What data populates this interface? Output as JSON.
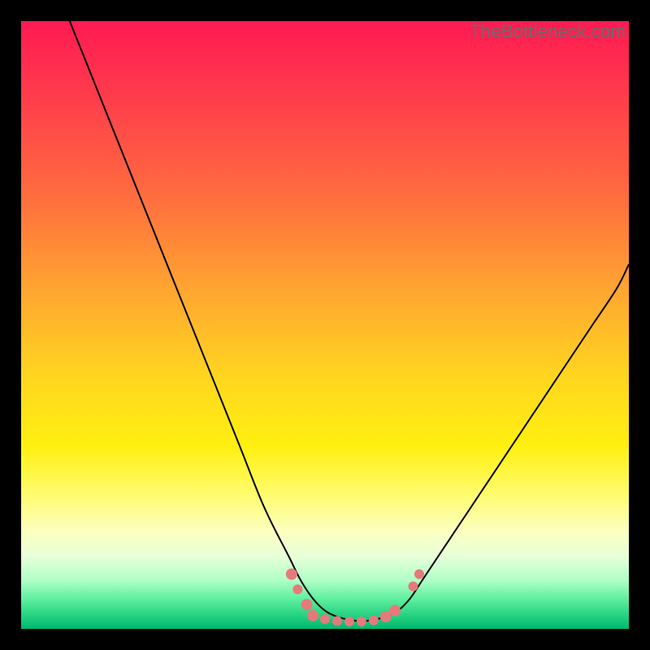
{
  "watermark": "TheBottleneck.com",
  "chart_data": {
    "type": "line",
    "title": "",
    "xlabel": "",
    "ylabel": "",
    "xlim": [
      0,
      100
    ],
    "ylim": [
      0,
      100
    ],
    "grid": false,
    "legend": false,
    "series": [
      {
        "name": "bottleneck-curve-left",
        "x": [
          8,
          12,
          16,
          20,
          24,
          28,
          32,
          36,
          40,
          44,
          46,
          48,
          50,
          52,
          54,
          56
        ],
        "y": [
          100,
          90,
          80,
          70,
          60,
          50,
          40,
          30,
          20,
          12,
          8,
          5,
          3,
          2,
          1.5,
          1.2
        ]
      },
      {
        "name": "bottleneck-curve-right",
        "x": [
          56,
          58,
          60,
          62,
          64,
          66,
          70,
          74,
          78,
          82,
          86,
          90,
          94,
          98,
          100
        ],
        "y": [
          1.2,
          1.5,
          2,
          3,
          5,
          8,
          14,
          20,
          26,
          32,
          38,
          44,
          50,
          56,
          60
        ]
      }
    ],
    "markers": [
      {
        "x": 44.5,
        "y": 9,
        "r": 7
      },
      {
        "x": 45.5,
        "y": 6.5,
        "r": 6
      },
      {
        "x": 47.0,
        "y": 4,
        "r": 7
      },
      {
        "x": 48.0,
        "y": 2.2,
        "r": 7
      },
      {
        "x": 50.0,
        "y": 1.6,
        "r": 6
      },
      {
        "x": 52.0,
        "y": 1.3,
        "r": 6
      },
      {
        "x": 54.0,
        "y": 1.2,
        "r": 6
      },
      {
        "x": 56.0,
        "y": 1.2,
        "r": 6
      },
      {
        "x": 58.0,
        "y": 1.4,
        "r": 6
      },
      {
        "x": 60.0,
        "y": 2.0,
        "r": 7
      },
      {
        "x": 61.5,
        "y": 3.0,
        "r": 7
      },
      {
        "x": 64.5,
        "y": 7.0,
        "r": 6
      },
      {
        "x": 65.5,
        "y": 9.0,
        "r": 6
      }
    ],
    "gradient_stops": [
      {
        "pos": 0,
        "color": "#ff1a52"
      },
      {
        "pos": 45,
        "color": "#ffa830"
      },
      {
        "pos": 70,
        "color": "#fff010"
      },
      {
        "pos": 100,
        "color": "#00b870"
      }
    ]
  }
}
